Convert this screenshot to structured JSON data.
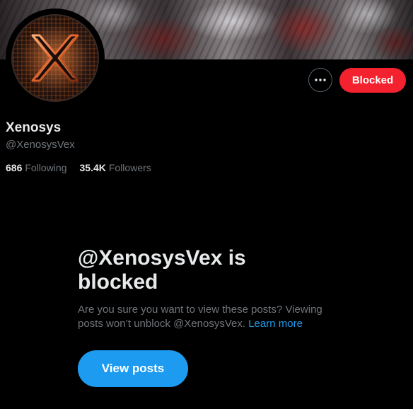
{
  "profile": {
    "display_name": "Xenosys",
    "handle": "@XenosysVex",
    "following_count": "686",
    "following_label": "Following",
    "followers_count": "35.4K",
    "followers_label": "Followers"
  },
  "actions": {
    "more_icon": "more-horizontal-icon",
    "blocked_label": "Blocked"
  },
  "blocked_notice": {
    "title": "@XenosysVex is blocked",
    "description": "Are you sure you want to view these posts? Viewing posts won’t unblock @XenosysVex.",
    "learn_more": "Learn more",
    "view_posts_label": "View posts"
  },
  "colors": {
    "background": "#000000",
    "primary_text": "#e7e9ea",
    "secondary_text": "#71767b",
    "blocked_button": "#f4212e",
    "accent_blue": "#1d9bf0"
  }
}
